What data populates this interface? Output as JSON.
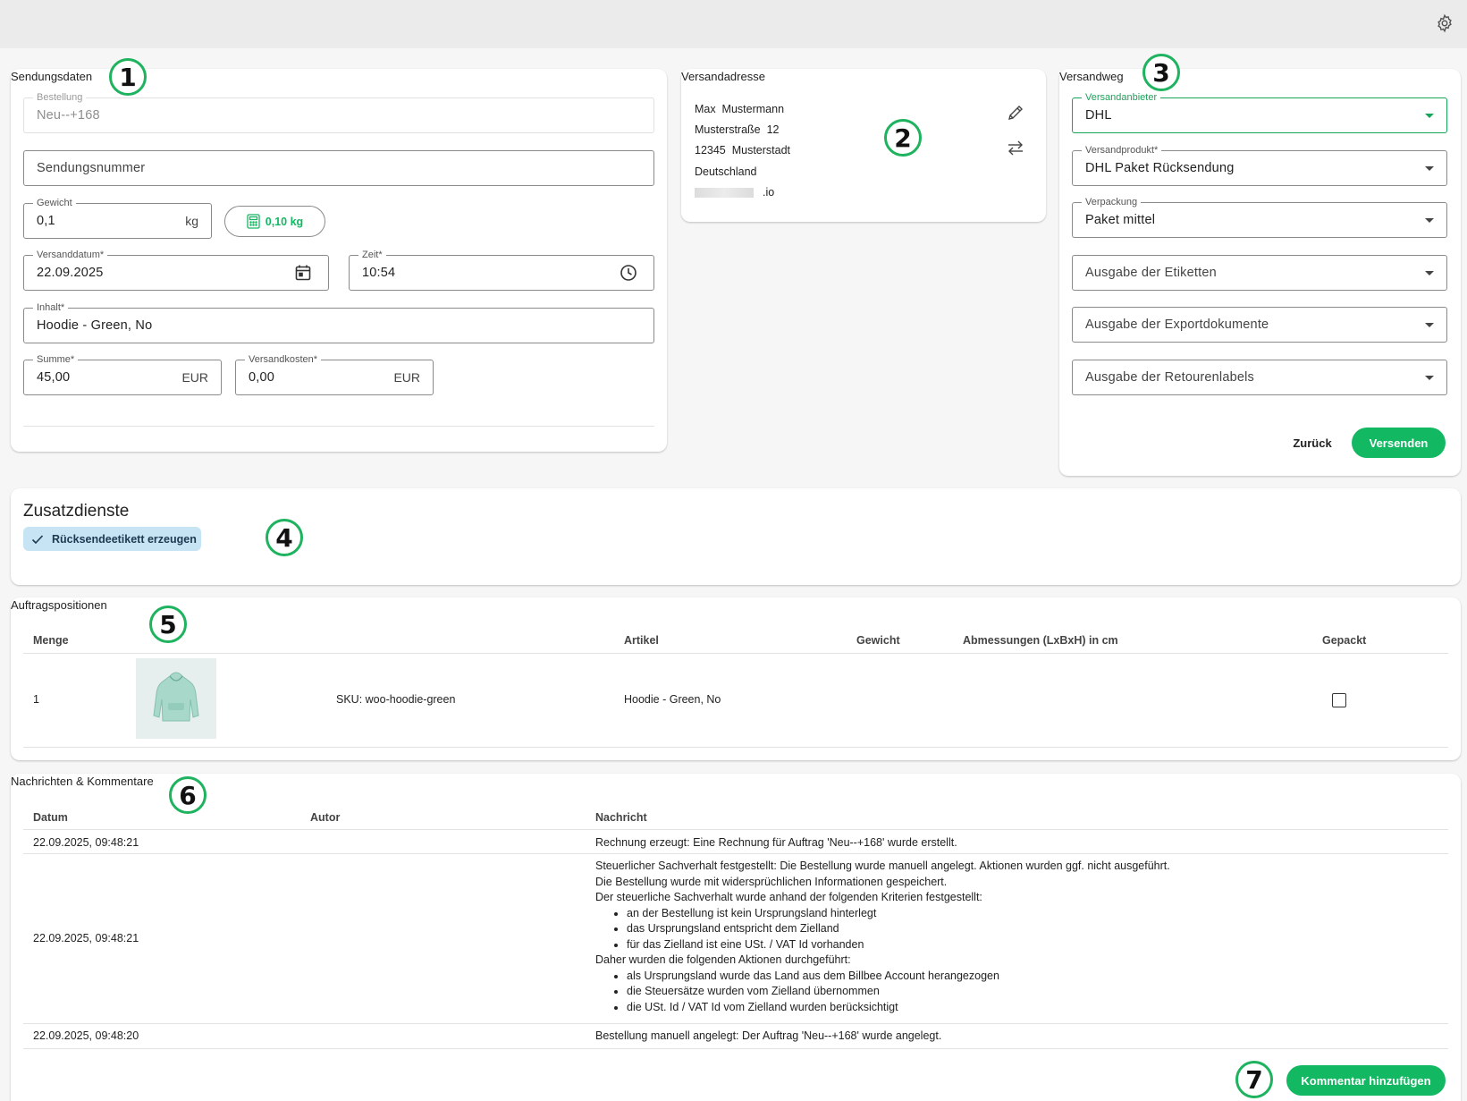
{
  "colors": {
    "accent": "#13b862",
    "chip_bg": "#c7e4f5",
    "badge_border": "#1fb35f"
  },
  "settings_icon": "gear-icon",
  "sendungsdaten": {
    "title": "Sendungsdaten",
    "bestellung_label": "Bestellung",
    "bestellung_value": "Neu--+168",
    "sendungsnummer_placeholder": "Sendungsnummer",
    "gewicht_label": "Gewicht",
    "gewicht_value": "0,1",
    "gewicht_unit": "kg",
    "calc_weight": "0,10 kg",
    "versanddatum_label": "Versanddatum*",
    "versanddatum_value": "22.09.2025",
    "zeit_label": "Zeit*",
    "zeit_value": "10:54",
    "inhalt_label": "Inhalt*",
    "inhalt_value": "Hoodie - Green, No",
    "summe_label": "Summe*",
    "summe_value": "45,00",
    "summe_currency": "EUR",
    "versandkosten_label": "Versandkosten*",
    "versandkosten_value": "0,00",
    "versandkosten_currency": "EUR"
  },
  "versandadresse": {
    "title": "Versandadresse",
    "lines": [
      "Max  Mustermann",
      "Musterstraße  12",
      "12345  Musterstadt",
      "Deutschland"
    ],
    "email_suffix": ".io"
  },
  "versandweg": {
    "title": "Versandweg",
    "anbieter_label": "Versandanbieter",
    "anbieter_value": "DHL",
    "produkt_label": "Versandprodukt*",
    "produkt_value": "DHL Paket Rücksendung",
    "verpackung_label": "Verpackung",
    "verpackung_value": "Paket mittel",
    "etiketten_placeholder": "Ausgabe der Etiketten",
    "export_placeholder": "Ausgabe der Exportdokumente",
    "retouren_placeholder": "Ausgabe der Retourenlabels",
    "back_label": "Zurück",
    "send_label": "Versenden"
  },
  "zusatzdienste": {
    "title": "Zusatzdienste",
    "chip_label": "Rücksendeetikett erzeugen"
  },
  "auftragspositionen": {
    "title": "Auftragspositionen",
    "headers": {
      "menge": "Menge",
      "artikel": "Artikel",
      "gewicht": "Gewicht",
      "abmessungen": "Abmessungen (LxBxH) in cm",
      "gepackt": "Gepackt"
    },
    "rows": [
      {
        "menge": "1",
        "sku": "SKU: woo-hoodie-green",
        "artikel": "Hoodie - Green, No",
        "gewicht": "",
        "abmessungen": "",
        "gepackt": false
      }
    ]
  },
  "nachrichten": {
    "title": "Nachrichten & Kommentare",
    "headers": {
      "datum": "Datum",
      "autor": "Autor",
      "nachricht": "Nachricht"
    },
    "row1": {
      "datum": "22.09.2025, 09:48:21",
      "autor": "",
      "nachricht": "Rechnung erzeugt: Eine Rechnung für Auftrag 'Neu--+168' wurde erstellt."
    },
    "row2": {
      "datum": "22.09.2025, 09:48:21",
      "autor": "",
      "line1": "Steuerlicher Sachverhalt festgestellt: Die Bestellung wurde manuell angelegt. Aktionen wurden ggf. nicht ausgeführt.",
      "line2": "Die Bestellung wurde mit widersprüchlichen Informationen gespeichert.",
      "line3": "Der steuerliche Sachverhalt wurde anhand der folgenden Kriterien festgestellt:",
      "criteria": [
        "an der Bestellung ist kein Ursprungsland hinterlegt",
        "das Ursprungsland entspricht dem Zielland",
        "für das Zielland ist eine USt. / VAT Id vorhanden"
      ],
      "line4": "Daher wurden die folgenden Aktionen durchgeführt:",
      "actions": [
        "als Ursprungsland wurde das Land aus dem Billbee Account herangezogen",
        "die Steuersätze wurden vom Zielland übernommen",
        "die USt. Id / VAT Id vom Zielland wurden berücksichtigt"
      ]
    },
    "row3": {
      "datum": "22.09.2025, 09:48:20",
      "autor": "",
      "nachricht": "Bestellung manuell angelegt: Der Auftrag 'Neu--+168' wurde angelegt."
    },
    "add_comment_label": "Kommentar hinzufügen"
  },
  "badges": [
    "1",
    "2",
    "3",
    "4",
    "5",
    "6",
    "7"
  ]
}
